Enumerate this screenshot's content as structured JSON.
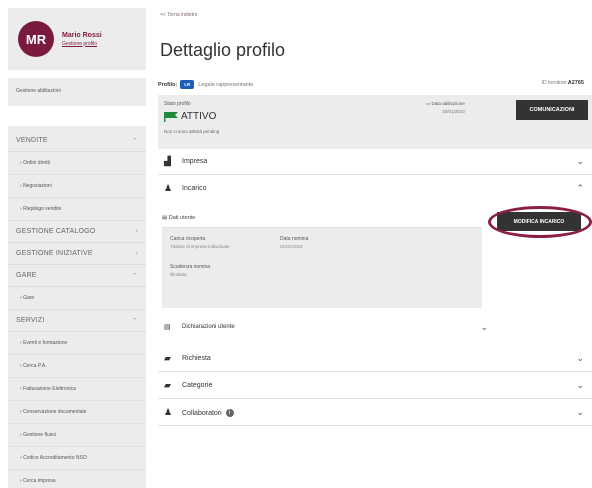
{
  "user": {
    "initials": "MR",
    "name": "Mario Rossi",
    "manage_link": "Gestione profilo"
  },
  "sidebar": {
    "block_label": "Gestione abilitazioni",
    "sections": [
      {
        "label": "VENDITE",
        "items": [
          "Ordini diretti",
          "Negoziazioni",
          "Riepilogo vendite"
        ]
      },
      {
        "label": "GESTIONE CATALOGO",
        "items": []
      },
      {
        "label": "GESTIONE INIZIATIVE",
        "items": []
      },
      {
        "label": "GARE",
        "items": [
          "Gare"
        ]
      },
      {
        "label": "SERVIZI",
        "items": [
          "Eventi e formazione",
          "Cerca P.A.",
          "Fatturazione Elettronica",
          "Conservazione documentale",
          "Gestione flussi",
          "Codice Accreditamento NSO",
          "Cerca impresa"
        ]
      }
    ]
  },
  "main": {
    "breadcrumb": "<< Torna indietro",
    "title": "Dettaglio profilo",
    "profile_label": "Profilo:",
    "profile_badge": "LR",
    "profile_last_update": "Legale rappresentante",
    "id_label": "ID fornitore",
    "id_value": "A2765",
    "status": {
      "label": "Stato profilo",
      "value": "ATTIVO",
      "note": "Non ci sono attività pending",
      "abil_label": "Data abilitazione",
      "abil_date": "20/01/2023",
      "comunicazioni_button": "COMUNICAZIONI"
    },
    "sections": {
      "impresa": "Impresa",
      "incarico": "Incarico",
      "richiesta": "Richiesta",
      "categorie": "Categorie",
      "collaboratori": "Collaboratori"
    },
    "utente": {
      "header": "Dati utente",
      "carica_label": "Carica ricoperta",
      "carica_value": "Titolare di impresa individuale",
      "nomina_label": "Data nomina",
      "nomina_value": "01/01/2023",
      "scadenza_label": "Scadenza nomina",
      "scadenza_value": "Illimitata"
    },
    "modifica_button": "MODIFICA INCARICO",
    "dichiarazioni": "Dichiarazioni utente"
  },
  "colors": {
    "brand": "#7b1a3f",
    "badge": "#1d5fb5",
    "flag": "#1e8a3e",
    "dark_button": "#333333"
  },
  "icons": [
    "building-icon",
    "person-icon",
    "id-card-icon",
    "folder-icon",
    "chevron-down-icon",
    "chevron-up-icon",
    "flag-icon",
    "calendar-icon",
    "info-icon"
  ]
}
